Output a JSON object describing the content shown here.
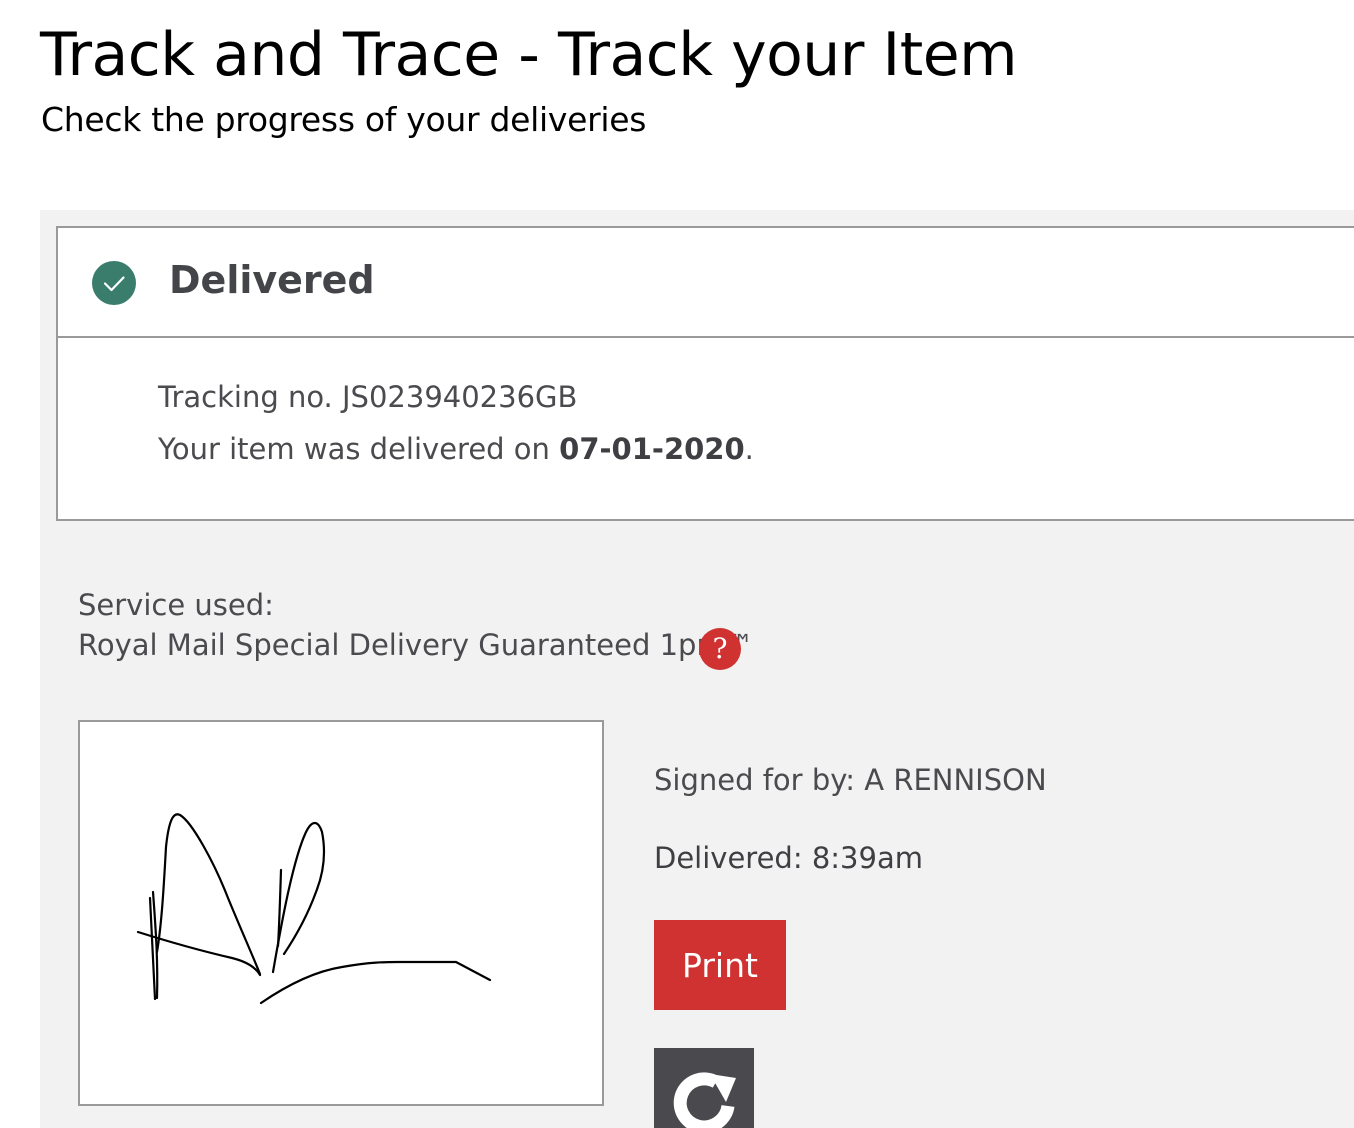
{
  "header": {
    "title": "Track and Trace - Track your Item",
    "subtitle": "Check the progress of your deliveries"
  },
  "status": {
    "label": "Delivered",
    "icon": "check-circle-icon",
    "color": "#3a7d6c"
  },
  "tracking": {
    "prefix": "Tracking no.",
    "number": "JS023940236GB",
    "delivered_prefix": "Your item was delivered on",
    "delivered_date": "07-01-2020",
    "delivered_suffix": "."
  },
  "service": {
    "label": "Service used:",
    "name": "Royal Mail Special Delivery Guaranteed 1pm™",
    "help_icon": "question-mark-icon",
    "help_symbol": "?"
  },
  "delivery": {
    "signed_for": "Signed for by: A RENNISON",
    "delivered_time": "Delivered: 8:39am"
  },
  "actions": {
    "print_label": "Print",
    "refresh_icon": "refresh-icon"
  },
  "colors": {
    "accent": "#d03131",
    "panel": "#f2f2f2",
    "dark_button": "#4a4a4e"
  }
}
